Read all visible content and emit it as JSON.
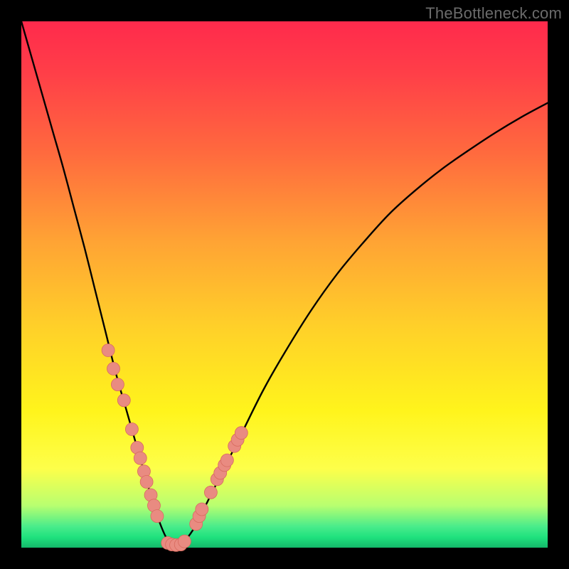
{
  "watermark": "TheBottleneck.com",
  "colors": {
    "background": "#000000",
    "curve_stroke": "#000000",
    "marker_fill": "#e98b81",
    "marker_stroke": "#d86b5f"
  },
  "chart_data": {
    "type": "line",
    "title": "",
    "xlabel": "",
    "ylabel": "",
    "xlim": [
      0,
      100
    ],
    "ylim": [
      0,
      100
    ],
    "grid": false,
    "legend": false,
    "x": [
      0,
      2,
      4,
      6,
      8,
      10,
      12,
      14,
      16,
      18,
      20,
      22,
      24,
      25.5,
      27,
      28,
      29,
      30,
      31,
      33,
      35,
      38,
      42,
      46,
      50,
      55,
      60,
      65,
      70,
      75,
      80,
      85,
      90,
      95,
      100
    ],
    "values": [
      100,
      93,
      86,
      79,
      72,
      64.5,
      57,
      49,
      41,
      33,
      26,
      19,
      12,
      7,
      3,
      1.2,
      0.5,
      0.5,
      1.2,
      4,
      8,
      14,
      22,
      30,
      37,
      45,
      52,
      58,
      63.5,
      68,
      72,
      75.5,
      78.8,
      81.8,
      84.5
    ],
    "markers": {
      "left_branch_x": [
        16.5,
        17.5,
        18.3,
        19.5,
        21.0,
        22.0,
        22.6,
        23.3,
        23.8,
        24.6,
        25.2,
        25.8
      ],
      "left_branch_y": [
        37.5,
        34.0,
        31.0,
        28.0,
        22.5,
        19.0,
        17.0,
        14.5,
        12.5,
        10.0,
        8.0,
        6.0
      ],
      "bottom_x": [
        27.8,
        28.6,
        29.4,
        30.3,
        31.0
      ],
      "bottom_y": [
        0.9,
        0.6,
        0.5,
        0.6,
        1.2
      ],
      "right_branch_x": [
        33.2,
        33.8,
        34.3,
        36.0,
        37.2,
        37.8,
        38.6,
        39.1,
        40.5,
        41.1,
        41.8
      ],
      "right_branch_y": [
        4.5,
        6.0,
        7.3,
        10.5,
        13.0,
        14.2,
        15.7,
        16.6,
        19.3,
        20.5,
        21.8
      ]
    }
  }
}
